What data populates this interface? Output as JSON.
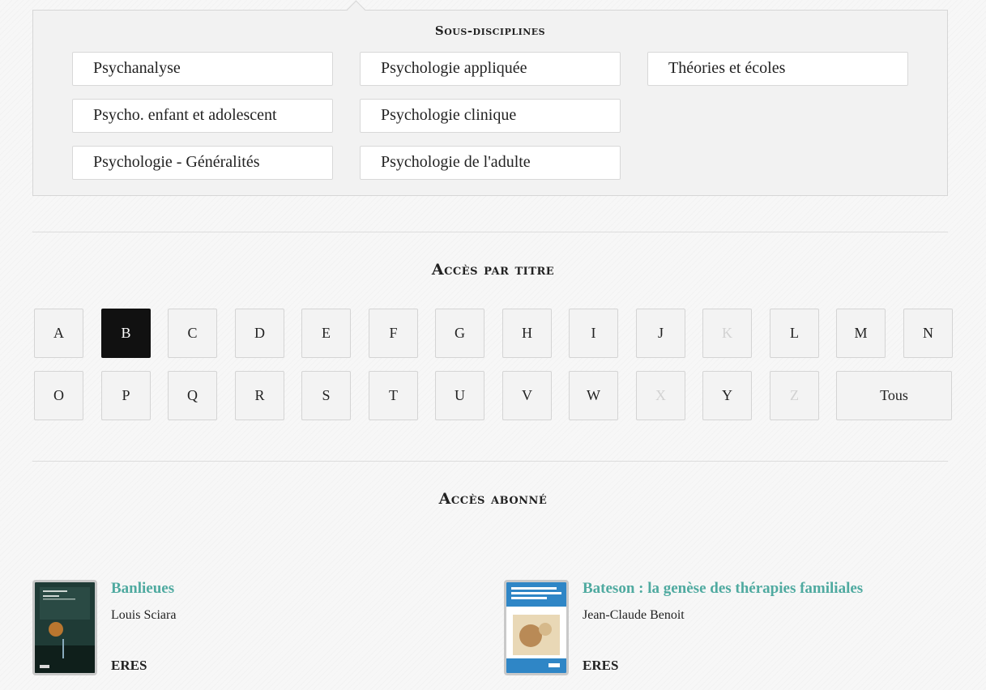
{
  "subdisciplines": {
    "title": "Sous-disciplines",
    "items": [
      "Psychanalyse",
      "Psychologie appliquée",
      "Théories et écoles",
      "Psycho. enfant et adolescent",
      "Psychologie clinique",
      "Psychologie - Généralités",
      "Psychologie de l'adulte"
    ]
  },
  "title_access": {
    "title": "Accès par titre",
    "letters_row1": [
      "A",
      "B",
      "C",
      "D",
      "E",
      "F",
      "G",
      "H",
      "I",
      "J",
      "K",
      "L",
      "M",
      "N"
    ],
    "letters_row2": [
      "O",
      "P",
      "Q",
      "R",
      "S",
      "T",
      "U",
      "V",
      "W",
      "X",
      "Y",
      "Z"
    ],
    "all_label": "Tous",
    "active_letter": "B",
    "disabled_letters": [
      "K",
      "X",
      "Z"
    ]
  },
  "subscriber_access": {
    "title": "Accès abonné",
    "books": [
      {
        "title": "Banlieues",
        "author": "Louis Sciara",
        "publisher": "ERES"
      },
      {
        "title": "Bateson : la genèse des thérapies familiales",
        "author": "Jean-Claude Benoit",
        "publisher": "ERES"
      }
    ]
  },
  "colors": {
    "accent_link": "#4faaa0",
    "active_letter_bg": "#111111"
  }
}
